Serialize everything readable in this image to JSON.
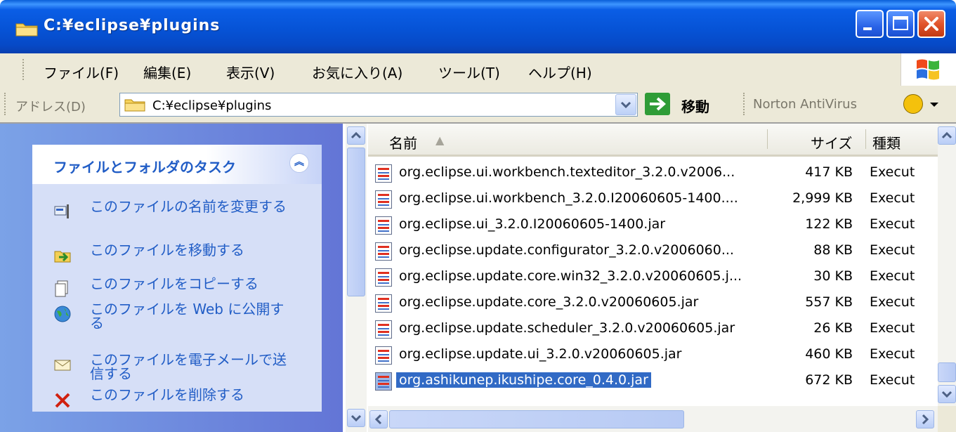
{
  "window": {
    "title": "C:¥eclipse¥plugins",
    "controls": [
      "minimize",
      "maximize",
      "close"
    ]
  },
  "menubar": {
    "items": [
      "ファイル(F)",
      "編集(E)",
      "表示(V)",
      "お気に入り(A)",
      "ツール(T)",
      "ヘルプ(H)"
    ]
  },
  "addressbar": {
    "label": "アドレス(D)",
    "value": "C:¥eclipse¥plugins",
    "go_label": "移動",
    "norton_label": "Norton AntiVirus"
  },
  "taskpane": {
    "title": "ファイルとフォルダのタスク",
    "tasks": [
      {
        "label": "このファイルの名前を変更する",
        "icon": "rename-icon"
      },
      {
        "label": "このファイルを移動する",
        "icon": "move-icon"
      },
      {
        "label": "このファイルをコピーする",
        "icon": "copy-icon"
      },
      {
        "label": "このファイルを Web に公開する",
        "icon": "web-publish-icon"
      },
      {
        "label": "このファイルを電子メールで送信する",
        "icon": "email-icon"
      },
      {
        "label": "このファイルを削除する",
        "icon": "delete-icon"
      }
    ]
  },
  "filelist": {
    "columns": [
      "名前",
      "サイズ",
      "種類"
    ],
    "sort_indicator": "▲",
    "rows": [
      {
        "name": "org.eclipse.ui.workbench.texteditor_3.2.0.v2006...",
        "size": "417 KB",
        "type": "Execut",
        "selected": false
      },
      {
        "name": "org.eclipse.ui.workbench_3.2.0.I20060605-1400....",
        "size": "2,999 KB",
        "type": "Execut",
        "selected": false
      },
      {
        "name": "org.eclipse.ui_3.2.0.I20060605-1400.jar",
        "size": "122 KB",
        "type": "Execut",
        "selected": false
      },
      {
        "name": "org.eclipse.update.configurator_3.2.0.v2006060...",
        "size": "88 KB",
        "type": "Execut",
        "selected": false
      },
      {
        "name": "org.eclipse.update.core.win32_3.2.0.v20060605.j...",
        "size": "30 KB",
        "type": "Execut",
        "selected": false
      },
      {
        "name": "org.eclipse.update.core_3.2.0.v20060605.jar",
        "size": "557 KB",
        "type": "Execut",
        "selected": false
      },
      {
        "name": "org.eclipse.update.scheduler_3.2.0.v20060605.jar",
        "size": "26 KB",
        "type": "Execut",
        "selected": false
      },
      {
        "name": "org.eclipse.update.ui_3.2.0.v20060605.jar",
        "size": "460 KB",
        "type": "Execut",
        "selected": false
      },
      {
        "name": "org.ashikunep.ikushipe.core_0.4.0.jar",
        "size": "672 KB",
        "type": "Execut",
        "selected": true
      }
    ]
  },
  "colors": {
    "titlebar": "#0653d6",
    "selection": "#316ac5",
    "task_link": "#215dc6",
    "taskpane_bg": "#7ba2e7"
  }
}
